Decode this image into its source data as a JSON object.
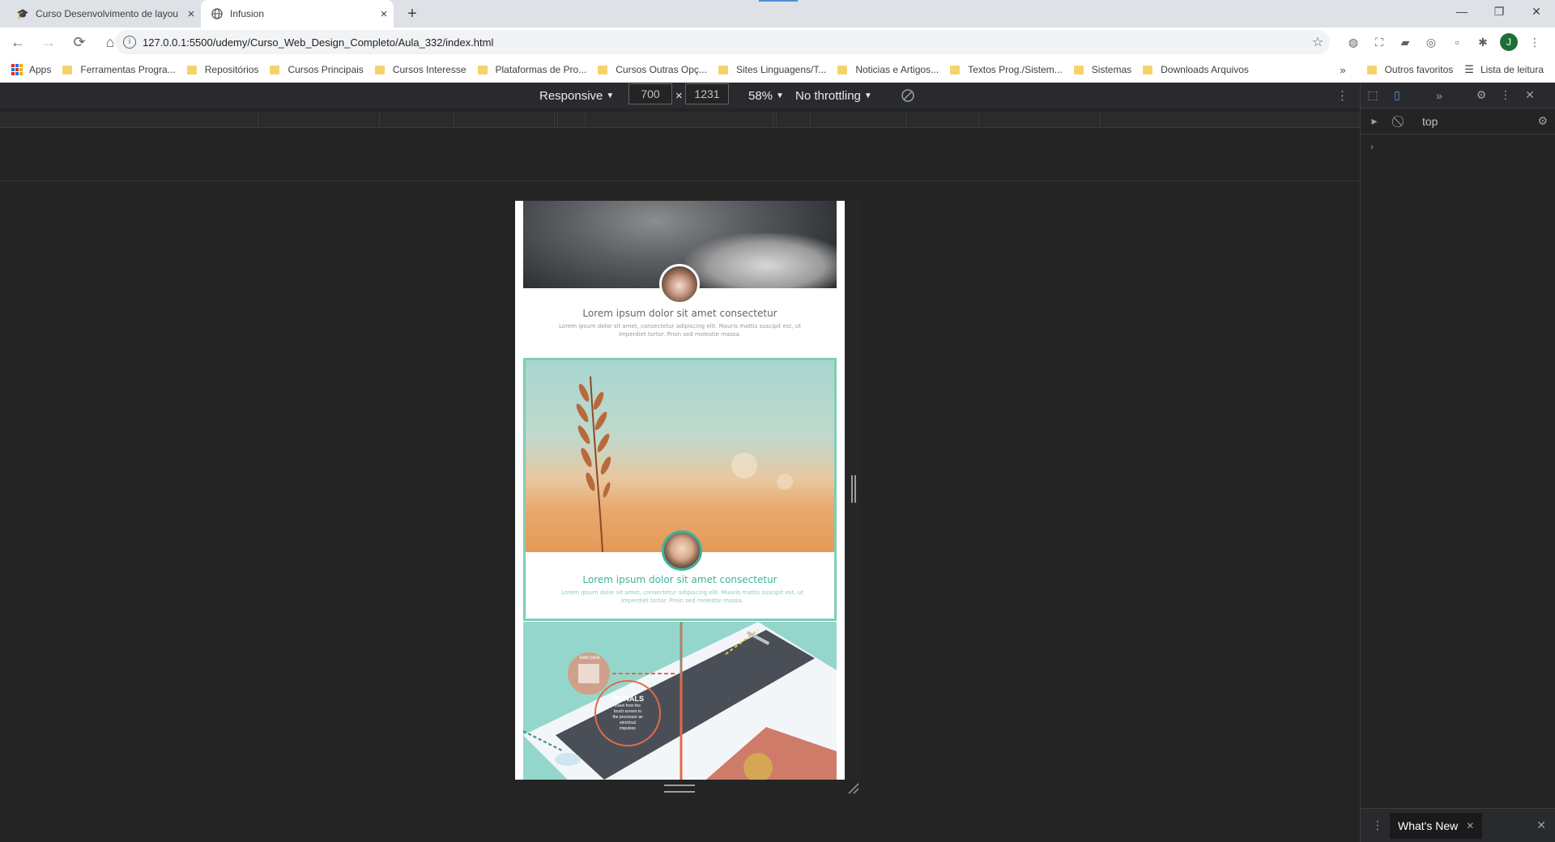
{
  "tabs": [
    {
      "title": "Curso Desenvolvimento de layou",
      "icon": "graduation-icon"
    },
    {
      "title": "Infusion",
      "icon": "globe-icon"
    }
  ],
  "address_bar": {
    "url": "127.0.0.1:5500/udemy/Curso_Web_Design_Completo/Aula_332/index.html"
  },
  "profile_initial": "J",
  "bookmarks": {
    "apps_label": "Apps",
    "items": [
      "Ferramentas Progra...",
      "Repositórios",
      "Cursos Principais",
      "Cursos Interesse",
      "Plataformas de Pro...",
      "Cursos Outras Opç...",
      "Sites Linguagens/T...",
      "Noticias e Artigos...",
      "Textos Prog./Sistem...",
      "Sistemas",
      "Downloads Arquivos"
    ],
    "more": "»",
    "other_favorites": "Outros favoritos",
    "reading_list": "Lista de leitura"
  },
  "device_toolbar": {
    "mode": "Responsive",
    "width": "700",
    "height": "1231",
    "times": "×",
    "zoom": "58%",
    "throttling": "No throttling"
  },
  "page": {
    "card1": {
      "title": "Lorem ipsum dolor sit amet consectetur",
      "text": "Lorem ipsum dolor sit amet, consectetur adipiscing elit. Mauris mattis suscipit est, ut imperdiet tortor. Proin sed molestie massa."
    },
    "card2": {
      "title": "Lorem ipsum dolor sit amet consectetur",
      "text": "Lorem ipsum dolor sit amet, consectetur adipiscing elit. Mauris mattis suscipit est, ut imperdiet tortor. Proin sed molestie massa."
    },
    "card3": {
      "signals_title": "SIGNALS",
      "signals_text": "travel from the touch screen to the processor as electrical impulses",
      "badge": "RAM DATA"
    }
  },
  "console": {
    "context": "top",
    "drawer_tab": "What's New"
  },
  "colors": {
    "teal": "#3fb39c",
    "folder": "#f5d36b",
    "devtools_bg": "#242424"
  }
}
